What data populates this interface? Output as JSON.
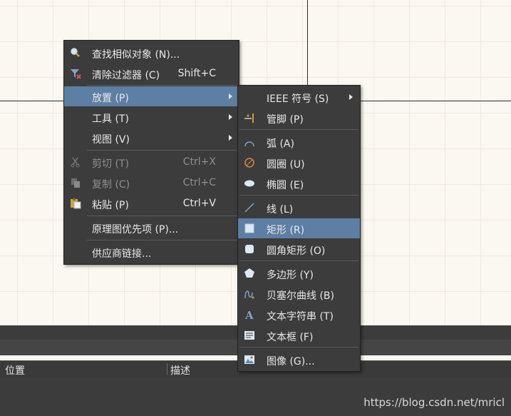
{
  "context_menu": {
    "items": [
      {
        "label": "查找相似对象 (N)...",
        "shortcut": "",
        "icon": "find-similar-icon",
        "disabled": false
      },
      {
        "label": "清除过滤器 (C)",
        "shortcut": "Shift+C",
        "icon": "clear-filter-icon",
        "disabled": false
      },
      {
        "label": "放置 (P)",
        "shortcut": "",
        "icon": "",
        "disabled": false,
        "submenu": true,
        "highlighted": true
      },
      {
        "label": "工具 (T)",
        "shortcut": "",
        "icon": "",
        "disabled": false,
        "submenu": true
      },
      {
        "label": "视图 (V)",
        "shortcut": "",
        "icon": "",
        "disabled": false,
        "submenu": true
      },
      {
        "label": "剪切 (T)",
        "shortcut": "Ctrl+X",
        "icon": "cut-icon",
        "disabled": true
      },
      {
        "label": "复制 (C)",
        "shortcut": "Ctrl+C",
        "icon": "copy-icon",
        "disabled": true
      },
      {
        "label": "粘贴 (P)",
        "shortcut": "Ctrl+V",
        "icon": "paste-icon",
        "disabled": false
      },
      {
        "label": "原理图优先项 (P)...",
        "shortcut": "",
        "icon": "",
        "disabled": false
      },
      {
        "label": "供应商链接...",
        "shortcut": "",
        "icon": "",
        "disabled": false
      }
    ]
  },
  "place_submenu": {
    "items": [
      {
        "label": "IEEE 符号 (S)",
        "icon": "",
        "submenu": true
      },
      {
        "label": "管脚 (P)",
        "icon": "pin-icon"
      },
      {
        "label": "弧 (A)",
        "icon": "arc-icon"
      },
      {
        "label": "圆圈 (U)",
        "icon": "circle-icon"
      },
      {
        "label": "椭圆 (E)",
        "icon": "ellipse-icon"
      },
      {
        "label": "线 (L)",
        "icon": "line-icon"
      },
      {
        "label": "矩形 (R)",
        "icon": "rectangle-icon",
        "highlighted": true
      },
      {
        "label": "圆角矩形 (O)",
        "icon": "round-rectangle-icon"
      },
      {
        "label": "多边形 (Y)",
        "icon": "polygon-icon"
      },
      {
        "label": "贝塞尔曲线 (B)",
        "icon": "bezier-icon"
      },
      {
        "label": "文本字符串 (T)",
        "icon": "text-string-icon"
      },
      {
        "label": "文本框 (F)",
        "icon": "text-frame-icon"
      },
      {
        "label": "图像 (G)...",
        "icon": "image-icon"
      }
    ]
  },
  "bottom_panel": {
    "col1": "位置",
    "col2": "描述"
  },
  "watermark": "https://blog.csdn.net/mricl",
  "colors": {
    "menu_bg": "#3c3c3c",
    "highlight": "#5d7fa3",
    "canvas_bg": "#fbf8f1"
  }
}
